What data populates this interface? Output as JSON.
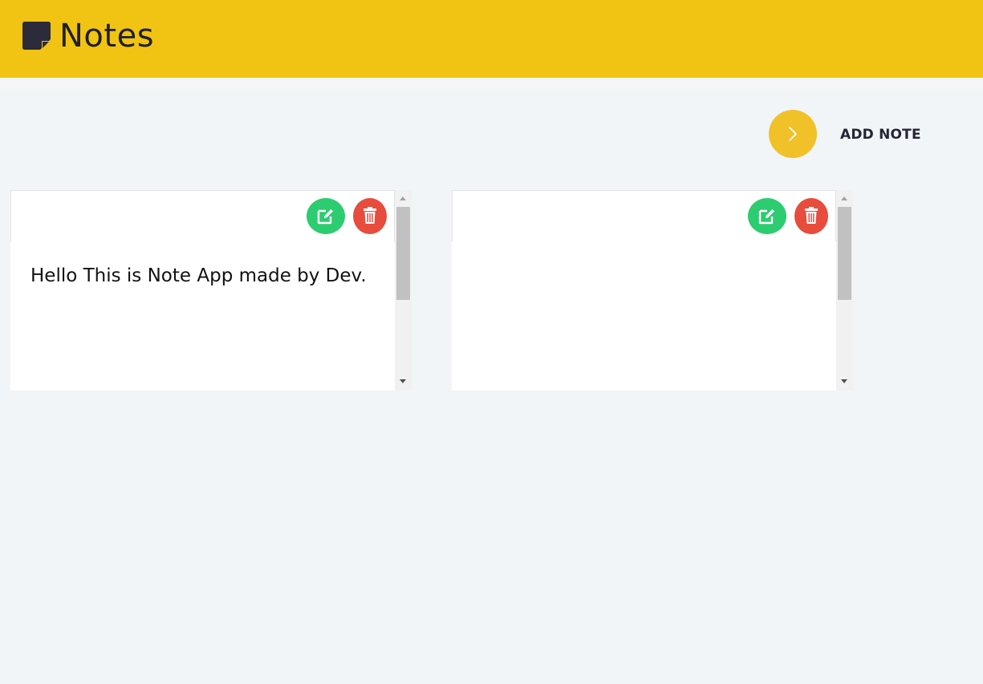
{
  "header": {
    "title": "Notes",
    "logo_icon": "sticky-note-icon",
    "background_color": "#f1c413"
  },
  "toolbar": {
    "add_button_icon": "chevron-right-icon",
    "add_label": "ADD NOTE",
    "add_button_color": "#f1c12a"
  },
  "notes": [
    {
      "text": "Hello This is Note App made by Dev.",
      "edit_icon": "edit-icon",
      "delete_icon": "trash-icon"
    },
    {
      "text": "",
      "edit_icon": "edit-icon",
      "delete_icon": "trash-icon"
    }
  ],
  "colors": {
    "edit": "#2ecc71",
    "delete": "#e74c3c"
  }
}
